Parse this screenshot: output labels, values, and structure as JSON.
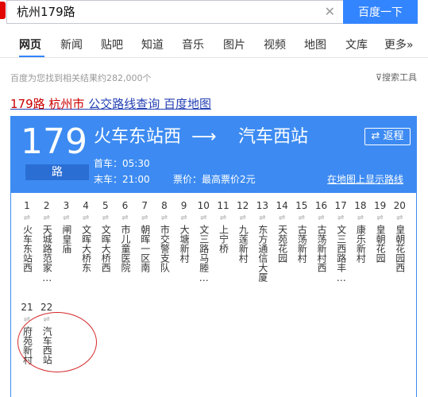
{
  "search": {
    "query": "杭州179路",
    "clear_icon": "close-icon",
    "button_label": "百度一下"
  },
  "tabs": [
    "网页",
    "新闻",
    "贴吧",
    "知道",
    "音乐",
    "图片",
    "视频",
    "地图",
    "文库",
    "更多»"
  ],
  "active_tab": "网页",
  "result_count": "百度为您找到相关结果约282,000个",
  "tools_label": "搜索工具",
  "tools_icon": "filter-icon",
  "result_title": {
    "prefix": "179路",
    "city": "杭州市",
    "rest": "公交路线查询 百度地图"
  },
  "route": {
    "number": "179",
    "suffix": "路",
    "from": "火车东站西",
    "arrow": "⟶",
    "to": "汽车西站",
    "return_label": "返程",
    "return_icon": "swap-icon",
    "first_bus": "首车：05:30",
    "last_bus": "末车：21:00",
    "fare": "票价：最高票价2元",
    "map_link": "在地图上显示路线",
    "accent": "#3d8bf2"
  },
  "stops": [
    {
      "num": "1",
      "name": "火车东站西"
    },
    {
      "num": "2",
      "name": "天城路范家…"
    },
    {
      "num": "3",
      "name": "闸皇庙"
    },
    {
      "num": "4",
      "name": "文晖大桥东"
    },
    {
      "num": "5",
      "name": "文晖大桥西"
    },
    {
      "num": "6",
      "name": "市儿童医院"
    },
    {
      "num": "7",
      "name": "朝晖一区南"
    },
    {
      "num": "8",
      "name": "市交警支队"
    },
    {
      "num": "9",
      "name": "大塘新村"
    },
    {
      "num": "10",
      "name": "文三路马塍…"
    },
    {
      "num": "11",
      "name": "上宁桥"
    },
    {
      "num": "12",
      "name": "九莲新村"
    },
    {
      "num": "13",
      "name": "东方通信大厦"
    },
    {
      "num": "14",
      "name": "天苑花园"
    },
    {
      "num": "15",
      "name": "古荡新村"
    },
    {
      "num": "16",
      "name": "古荡新村西"
    },
    {
      "num": "17",
      "name": "文三西路丰…"
    },
    {
      "num": "18",
      "name": "康乐新村"
    },
    {
      "num": "19",
      "name": "皇朝花园"
    },
    {
      "num": "20",
      "name": "皇朝花园西"
    },
    {
      "num": "21",
      "name": "府苑新村"
    },
    {
      "num": "22",
      "name": "汽车西站"
    }
  ]
}
